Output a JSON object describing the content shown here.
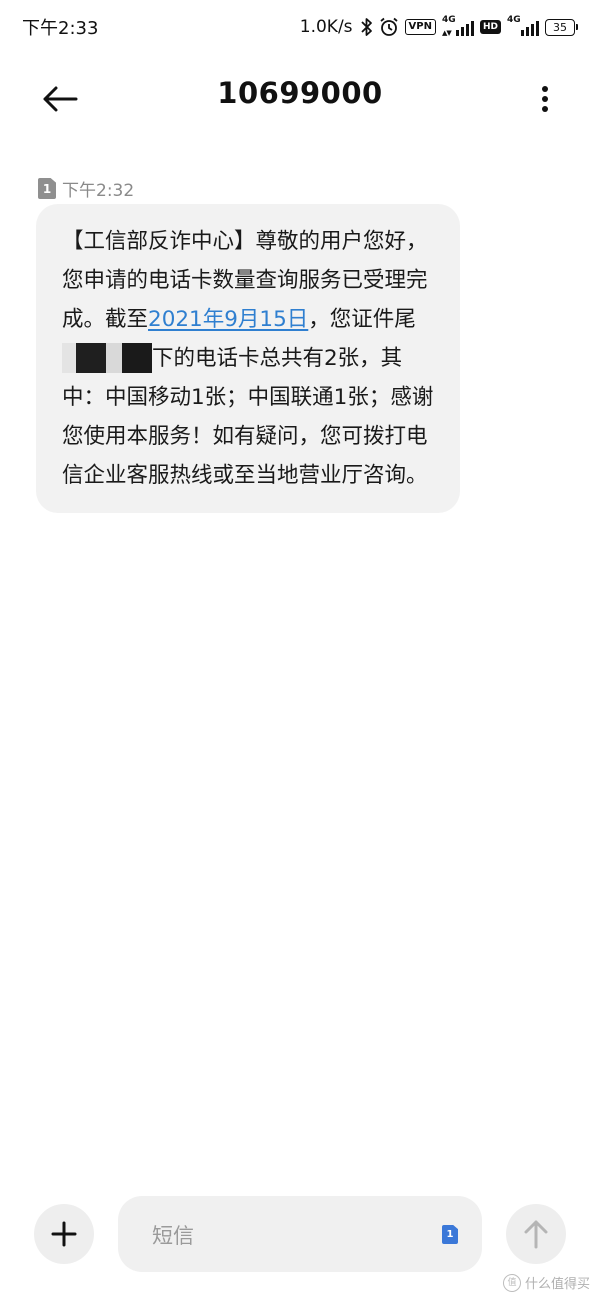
{
  "status_bar": {
    "time": "下午2:33",
    "net_speed": "1.0K/s",
    "vpn_label": "VPN",
    "network_1": "4G",
    "hd_label": "HD",
    "network_2": "4G",
    "battery_level": "35"
  },
  "header": {
    "title": "10699000",
    "back_icon": "arrow-left-icon",
    "more_icon": "more-vertical-icon"
  },
  "message": {
    "sim_slot": "1",
    "time": "下午2:32",
    "text_before_link": "【工信部反诈中心】尊敬的用户您好，您申请的电话卡数量查询服务已受理完成。截至",
    "link_text": "2021年9月15日",
    "text_after_link_1": "，您证件尾",
    "text_after_redact": "下的电话卡总共有2张，其中：中国移动1张；中国联通1张；感谢您使用本服务！如有疑问，您可拨打电信企业客服热线或至当地营业厅咨询。",
    "link_color": "#2f7fd0",
    "bubble_color": "#f2f2f2"
  },
  "composer": {
    "add_icon": "plus-icon",
    "placeholder": "短信",
    "sim_badge": "1",
    "send_icon": "arrow-up-icon"
  },
  "watermark": {
    "text": "什么值得买",
    "icon_text": "值"
  }
}
